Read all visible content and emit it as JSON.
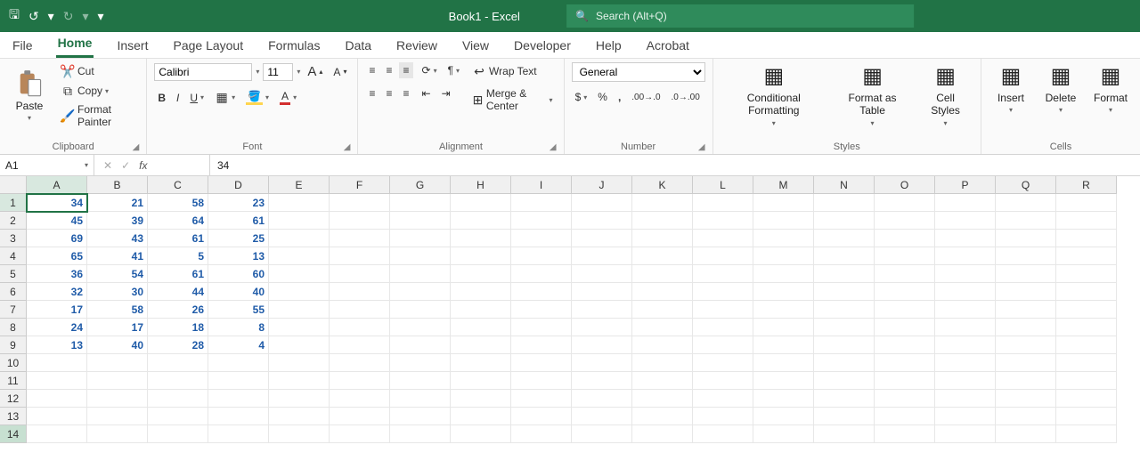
{
  "title": "Book1  -  Excel",
  "search_placeholder": "Search (Alt+Q)",
  "tabs": [
    "File",
    "Home",
    "Insert",
    "Page Layout",
    "Formulas",
    "Data",
    "Review",
    "View",
    "Developer",
    "Help",
    "Acrobat"
  ],
  "active_tab_index": 1,
  "ribbon": {
    "clipboard": {
      "label": "Clipboard",
      "paste": "Paste",
      "cut": "Cut",
      "copy": "Copy",
      "painter": "Format Painter"
    },
    "font": {
      "label": "Font",
      "name": "Calibri",
      "size": "11"
    },
    "alignment": {
      "label": "Alignment",
      "wrap": "Wrap Text",
      "merge": "Merge & Center"
    },
    "number": {
      "label": "Number",
      "format": "General"
    },
    "styles": {
      "label": "Styles",
      "cond": "Conditional Formatting",
      "table": "Format as Table",
      "cell": "Cell Styles"
    },
    "cells": {
      "label": "Cells",
      "insert": "Insert",
      "delete": "Delete",
      "format": "Format"
    }
  },
  "namebox": "A1",
  "formula": "34",
  "columns": [
    "A",
    "B",
    "C",
    "D",
    "E",
    "F",
    "G",
    "H",
    "I",
    "J",
    "K",
    "L",
    "M",
    "N",
    "O",
    "P",
    "Q",
    "R"
  ],
  "row_count": 14,
  "selected_row_header": 14,
  "data": [
    [
      "34",
      "21",
      "58",
      "23"
    ],
    [
      "45",
      "39",
      "64",
      "61"
    ],
    [
      "69",
      "43",
      "61",
      "25"
    ],
    [
      "65",
      "41",
      "5",
      "13"
    ],
    [
      "36",
      "54",
      "61",
      "60"
    ],
    [
      "32",
      "30",
      "44",
      "40"
    ],
    [
      "17",
      "58",
      "26",
      "55"
    ],
    [
      "24",
      "17",
      "18",
      "8"
    ],
    [
      "13",
      "40",
      "28",
      "4"
    ]
  ],
  "selected_cell": {
    "row": 0,
    "col": 0
  }
}
